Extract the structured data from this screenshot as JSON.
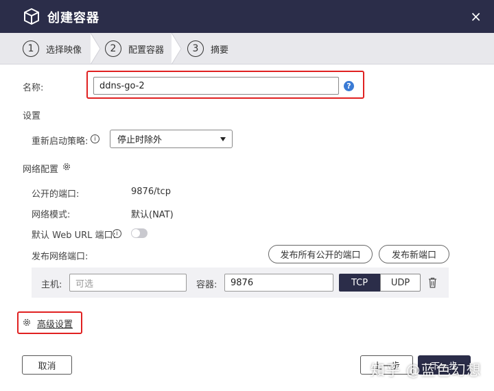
{
  "window": {
    "title": "创建容器",
    "close_glyph": "×"
  },
  "steps": [
    {
      "num": "1",
      "label": "选择映像"
    },
    {
      "num": "2",
      "label": "配置容器"
    },
    {
      "num": "3",
      "label": "摘要"
    }
  ],
  "name": {
    "label": "名称:",
    "value": "ddns-go-2",
    "help_glyph": "?"
  },
  "settings": {
    "heading": "设置",
    "restart_policy_label": "重新启动策略:",
    "restart_policy_value": "停止时除外"
  },
  "network": {
    "heading": "网络配置",
    "public_port_label": "公开的端口:",
    "public_port_value": "9876/tcp",
    "mode_label": "网络模式:",
    "mode_value": "默认(NAT)",
    "web_url_label": "默认 Web URL 端口:",
    "publish_label": "发布网络端口:",
    "publish_all_button": "发布所有公开的端口",
    "publish_new_button": "发布新端口",
    "host_label": "主机:",
    "host_placeholder": "可选",
    "container_label": "容器:",
    "container_value": "9876",
    "tcp_label": "TCP",
    "udp_label": "UDP",
    "web_url_toggle_on": false
  },
  "advanced": {
    "label": "高级设置"
  },
  "footer": {
    "cancel": "取消",
    "back": "上一步",
    "next": "下一步"
  },
  "watermark": "知乎 @蓝色幻想",
  "colors": {
    "titlebar": "#2b2d49",
    "highlight": "#e02020",
    "help": "#3a7bd5"
  },
  "icons": [
    "cube-icon",
    "close-icon",
    "help-icon",
    "info-icon",
    "gear-icon",
    "dropdown-caret-icon",
    "trash-icon"
  ]
}
